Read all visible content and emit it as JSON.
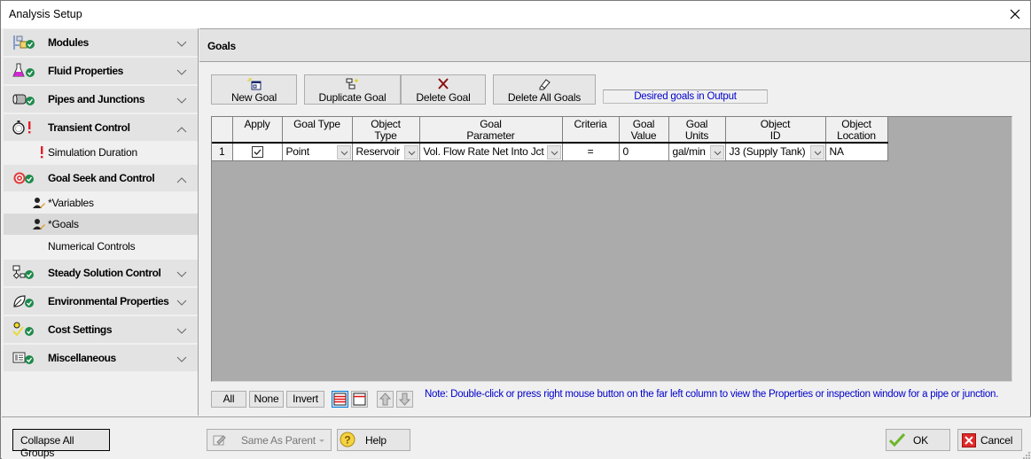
{
  "window": {
    "title": "Analysis Setup",
    "close_icon": "close-icon"
  },
  "sidebar": {
    "groups": [
      {
        "label": "Modules",
        "icon": "modules-icon",
        "status": "ok",
        "expanded": false
      },
      {
        "label": "Fluid Properties",
        "icon": "flask-icon",
        "status": "ok",
        "expanded": false
      },
      {
        "label": "Pipes and Junctions",
        "icon": "pipe-icon",
        "status": "ok",
        "expanded": false
      },
      {
        "label": "Transient Control",
        "icon": "stopwatch-icon",
        "status": "warning",
        "expanded": true,
        "items": [
          {
            "label": "Simulation Duration",
            "status": "warning"
          }
        ]
      },
      {
        "label": "Goal Seek and Control",
        "icon": "target-icon",
        "status": "ok",
        "expanded": true,
        "items": [
          {
            "label": "*Variables",
            "status": "edit"
          },
          {
            "label": "*Goals",
            "status": "edit",
            "selected": true
          },
          {
            "label": "Numerical Controls",
            "status": "none"
          }
        ]
      },
      {
        "label": "Steady Solution Control",
        "icon": "flowchart-icon",
        "status": "ok",
        "expanded": false
      },
      {
        "label": "Environmental Properties",
        "icon": "leaf-icon",
        "status": "ok",
        "expanded": false
      },
      {
        "label": "Cost Settings",
        "icon": "cost-icon",
        "status": "ok",
        "expanded": false
      },
      {
        "label": "Miscellaneous",
        "icon": "list-icon",
        "status": "ok",
        "expanded": false
      }
    ]
  },
  "main": {
    "title": "Goals",
    "toolbar": {
      "new_goal": "New Goal",
      "duplicate_goal": "Duplicate Goal",
      "delete_goal": "Delete Goal",
      "delete_all_goals": "Delete All Goals",
      "output_status": "Desired goals in Output"
    },
    "table": {
      "columns": [
        {
          "key": "row",
          "label": ""
        },
        {
          "key": "apply",
          "label": "Apply"
        },
        {
          "key": "goal_type",
          "label": "Goal Type"
        },
        {
          "key": "object_type",
          "label": "Object\nType"
        },
        {
          "key": "goal_parameter",
          "label": "Goal\nParameter"
        },
        {
          "key": "criteria",
          "label": "Criteria"
        },
        {
          "key": "goal_value",
          "label": "Goal\nValue"
        },
        {
          "key": "goal_units",
          "label": "Goal\nUnits"
        },
        {
          "key": "object_id",
          "label": "Object\nID"
        },
        {
          "key": "object_location",
          "label": "Object\nLocation"
        }
      ],
      "rows": [
        {
          "row": "1",
          "apply": true,
          "goal_type": "Point",
          "object_type": "Reservoir",
          "goal_parameter": "Vol. Flow Rate Net Into Jct",
          "criteria": "=",
          "goal_value": "0",
          "goal_units": "gal/min",
          "object_id": "J3 (Supply Tank)",
          "object_location": "NA"
        }
      ]
    },
    "selection": {
      "all": "All",
      "none": "None",
      "invert": "Invert"
    },
    "note": "Note: Double-click or press right mouse button on the far left column to view the Properties or inspection window for a pipe or junction."
  },
  "footer": {
    "collapse_all": "Collapse All Groups",
    "same_as_parent": "Same As Parent",
    "help": "Help",
    "ok": "OK",
    "cancel": "Cancel"
  },
  "colors": {
    "note_text": "#0000cc",
    "ok_check": "#1e8a4c",
    "warning": "#e0202a",
    "grid_background": "#ababab"
  }
}
